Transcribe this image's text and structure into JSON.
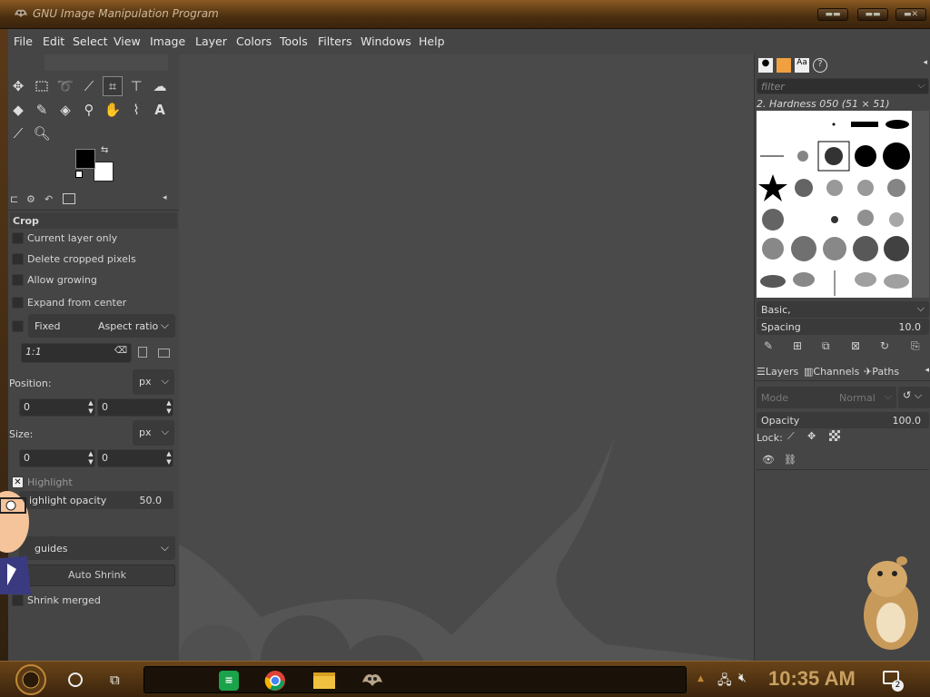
{
  "window": {
    "title": "GNU Image Manipulation Program"
  },
  "menu": [
    "File",
    "Edit",
    "Select",
    "View",
    "Image",
    "Layer",
    "Colors",
    "Tools",
    "Filters",
    "Windows",
    "Help"
  ],
  "tool_options": {
    "section_title": "Crop",
    "current_layer_only": "Current layer only",
    "delete_cropped": "Delete cropped pixels",
    "allow_growing": "Allow growing",
    "expand_from_center": "Expand from center",
    "fixed": "Fixed",
    "aspect_ratio": "Aspect ratio",
    "ratio_value": "1:1",
    "position_label": "Position:",
    "position_unit": "px",
    "position_x": "0",
    "position_y": "0",
    "size_label": "Size:",
    "size_unit": "px",
    "size_x": "0",
    "size_y": "0",
    "highlight": "Highlight",
    "highlight_opacity_label": "ighlight opacity",
    "highlight_opacity_value": "50.0",
    "guides": "guides",
    "auto_shrink": "Auto Shrink",
    "shrink_merged": "Shrink merged"
  },
  "brushes": {
    "filter_placeholder": "filter",
    "selected_brush": "2. Hardness 050 (51 × 51)",
    "tag": "Basic,",
    "spacing_label": "Spacing",
    "spacing_value": "10.0"
  },
  "layers": {
    "tabs": [
      "Layers",
      "Channels",
      "Paths"
    ],
    "mode_label": "Mode",
    "mode_value": "Normal",
    "opacity_label": "Opacity",
    "opacity_value": "100.0",
    "lock_label": "Lock:"
  },
  "taskbar": {
    "time": "10:35 AM",
    "notification_count": "2"
  },
  "colors": {
    "gimp_bg": "#454545",
    "canvas": "#4a4a4a",
    "frame": "#5b3a18",
    "clock": "#c8a060"
  }
}
